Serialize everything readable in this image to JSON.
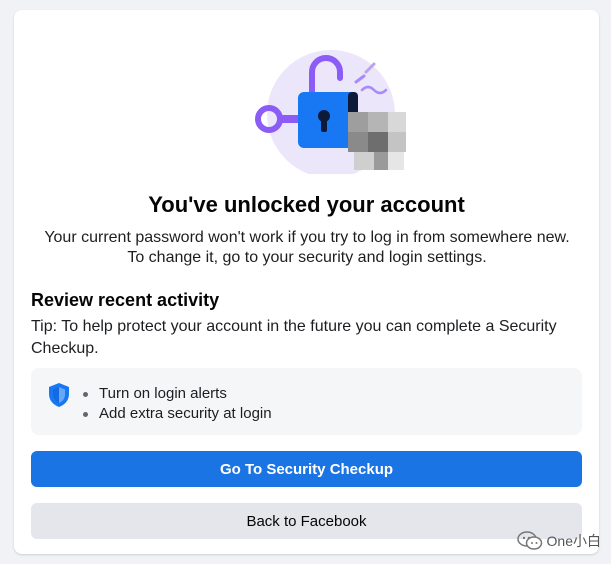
{
  "dialog": {
    "title": "You've unlocked your account",
    "subtitle": "Your current password won't work if you try to log in from somewhere new. To change it, go to your security and login settings."
  },
  "review": {
    "heading": "Review recent activity",
    "tip": "Tip: To help protect your account in the future you can complete a Security Checkup.",
    "items": [
      {
        "label": "Turn on login alerts"
      },
      {
        "label": "Add extra security at login"
      }
    ],
    "icon": "shield-icon"
  },
  "buttons": {
    "primary_label": "Go To Security Checkup",
    "secondary_label": "Back to Facebook"
  },
  "watermark": {
    "text": "One小白"
  },
  "colors": {
    "accent": "#1b74e4",
    "lock_body": "#1877f2",
    "key_purple": "#8b5cf6",
    "illustration_bg": "#e9e2fb",
    "secondary_button": "#e4e6eb"
  }
}
